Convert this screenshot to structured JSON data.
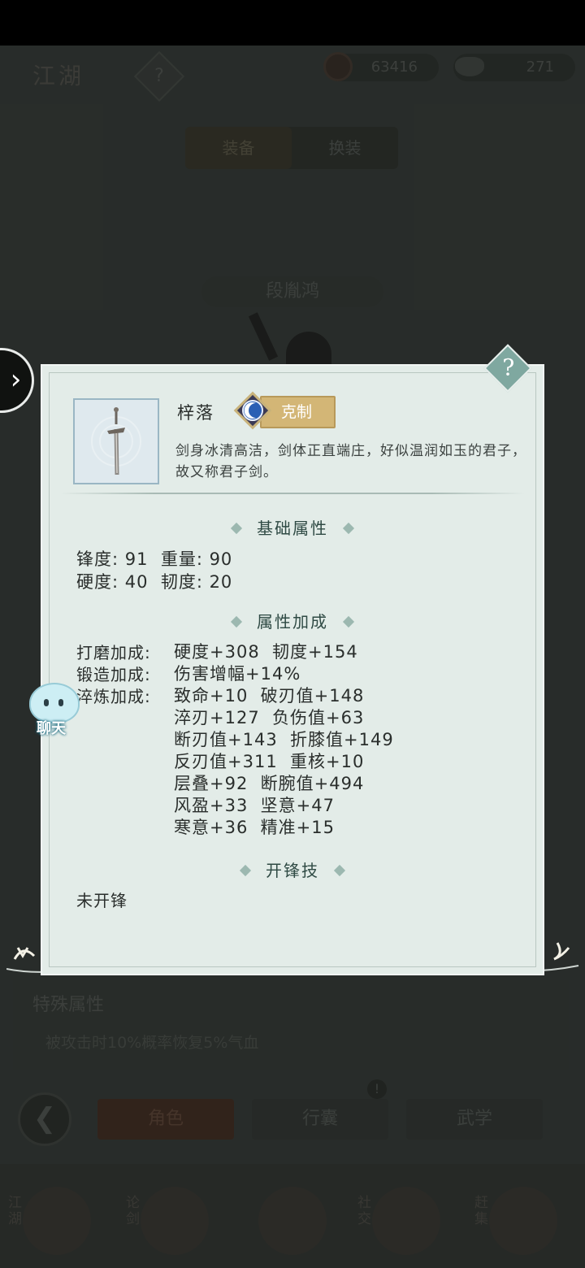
{
  "header": {
    "title": "江湖",
    "help_icon": "question-mark",
    "coins": "63416",
    "ingots": "271"
  },
  "tabs": {
    "equip": "装备",
    "change": "换装"
  },
  "character": {
    "name": "段胤鸿"
  },
  "special": {
    "title": "特殊属性",
    "text": "被攻击时10%概率恢复5%气血"
  },
  "nav": {
    "role": "角色",
    "bag": "行囊",
    "martial": "武学",
    "bag_alert": "!"
  },
  "bottom": [
    "江湖",
    "论剑",
    "",
    "社交",
    "赶集"
  ],
  "chat": {
    "label": "聊天"
  },
  "modal": {
    "help": "?",
    "item_name": "梓落",
    "badge": "克制",
    "description": "剑身冰清高洁，剑体正直端庄，好似温润如玉的君子，故又称君子剑。",
    "base_title": "基础属性",
    "base_lines": [
      "锋度: 91  重量: 90",
      "硬度: 40  韧度: 20"
    ],
    "bonus_title": "属性加成",
    "bonus_labels": [
      "打磨加成:",
      "锻造加成:",
      "淬炼加成:"
    ],
    "bonus_values": [
      "硬度+308  韧度+154",
      "伤害增幅+14%",
      "致命+10  破刃值+148",
      "淬刃+127  负伤值+63",
      "断刃值+143  折膝值+149",
      "反刃值+311  重核+10",
      "层叠+92  断腕值+494",
      "风盈+33  坚意+47",
      "寒意+36  精准+15"
    ],
    "skill_title": "开锋技",
    "skill_text": "未开锋"
  },
  "colors": {
    "modal_bg": "#e3ece8",
    "badge_gold": "#d3b676",
    "accent_teal": "#7fa8a0"
  }
}
